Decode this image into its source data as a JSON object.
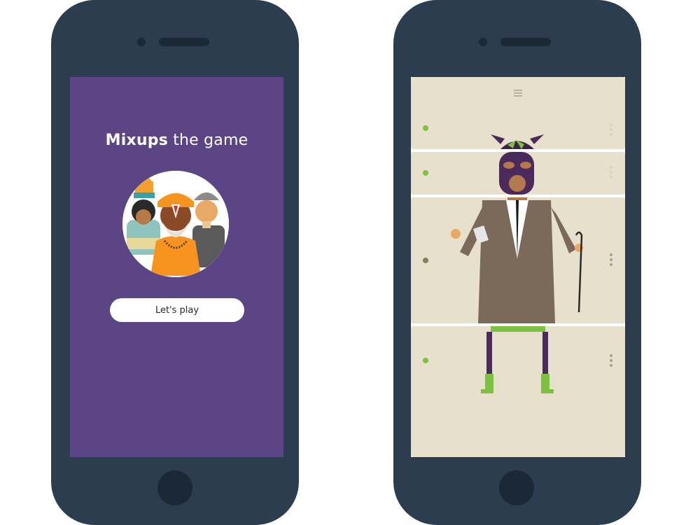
{
  "intro_screen": {
    "title_bold": "Mixups",
    "title_rest": " the game",
    "play_button": "Let's play",
    "portrait_icon": "three-characters-illustration",
    "colors": {
      "background": "#5b4585",
      "button": "#ffffff"
    }
  },
  "game_screen": {
    "menu_icon": "hamburger-menu-icon",
    "strips": [
      {
        "segment": "head",
        "indicator_color": "#7cc142"
      },
      {
        "segment": "face",
        "indicator_color": "#7cc142"
      },
      {
        "segment": "torso",
        "indicator_color": "#8c7b5b"
      },
      {
        "segment": "legs",
        "indicator_color": "#7cc142"
      }
    ],
    "colors": {
      "panel": "#e6e0cc",
      "handle": "#a8a08c"
    }
  },
  "device": {
    "frame_color": "#2c3d50"
  }
}
